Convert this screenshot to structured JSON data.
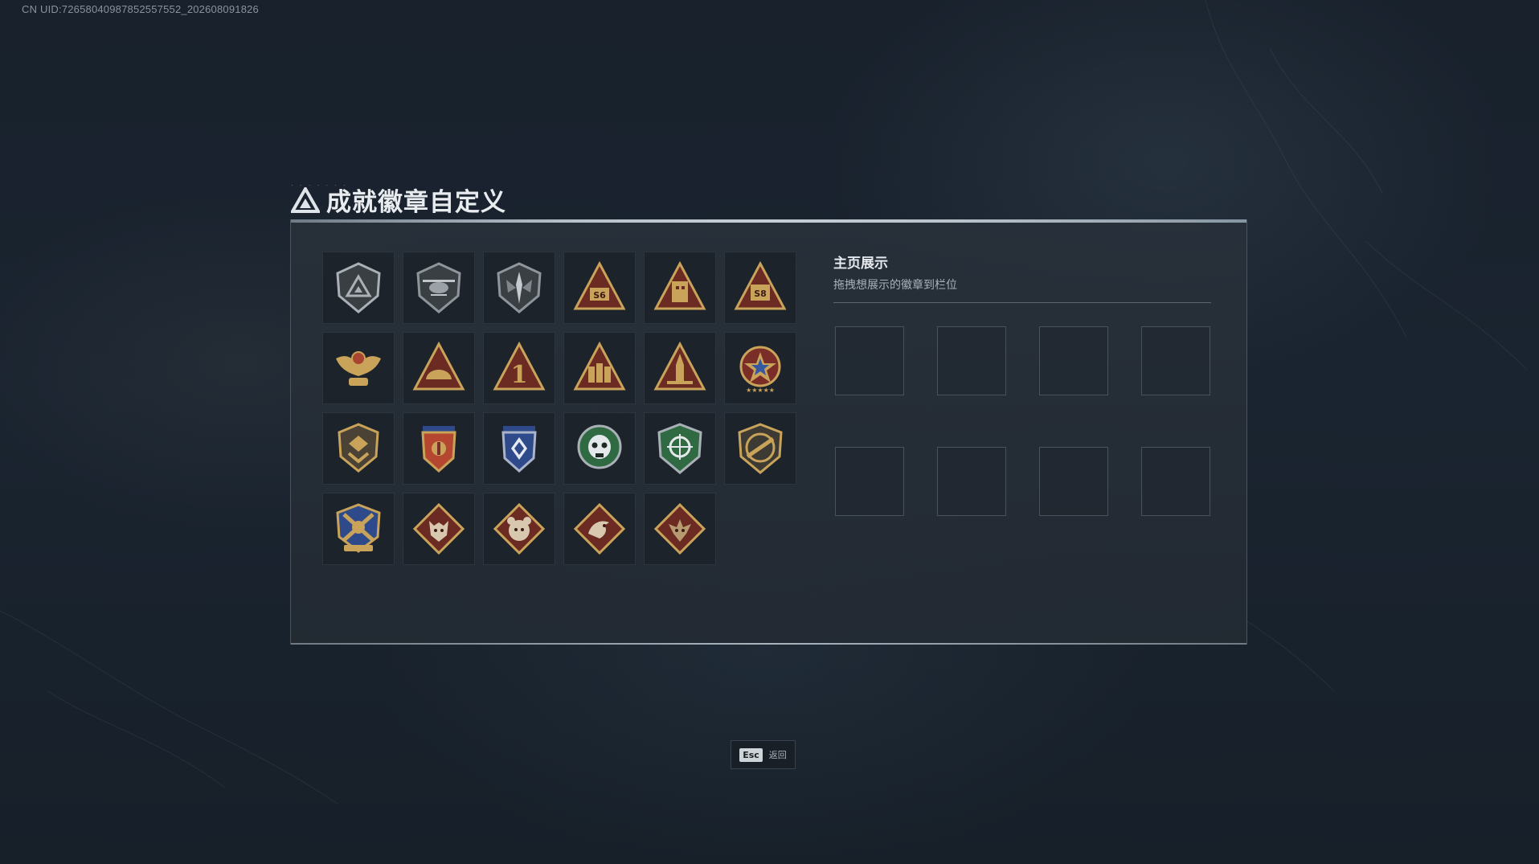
{
  "uid": "CN UID:72658040987852557552_202608091826",
  "title": "成就徽章自定义",
  "showcase": {
    "title": "主页展示",
    "subtitle": "拖拽想展示的徽章到栏位",
    "slot_count": 8
  },
  "badges": [
    {
      "icon": "shield-triangle-icon",
      "tone": "silver"
    },
    {
      "icon": "helicopter-shield-icon",
      "tone": "silver"
    },
    {
      "icon": "dagger-shield-icon",
      "tone": "silver"
    },
    {
      "icon": "triangle-s6-icon",
      "tone": "gold",
      "label": "S6"
    },
    {
      "icon": "triangle-building-icon",
      "tone": "gold"
    },
    {
      "icon": "triangle-s8-icon",
      "tone": "gold",
      "label": "S8"
    },
    {
      "icon": "eagle-crest-icon",
      "tone": "gold"
    },
    {
      "icon": "triangle-helmet-icon",
      "tone": "gold"
    },
    {
      "icon": "triangle-number-one-icon",
      "tone": "gold",
      "label": "1"
    },
    {
      "icon": "triangle-soldiers-icon",
      "tone": "gold"
    },
    {
      "icon": "triangle-rocket-icon",
      "tone": "gold"
    },
    {
      "icon": "star-medal-icon",
      "tone": "red"
    },
    {
      "icon": "shield-chevron-icon",
      "tone": "gold"
    },
    {
      "icon": "shield-flag-icon",
      "tone": "red"
    },
    {
      "icon": "shield-blue-star-icon",
      "tone": "blue"
    },
    {
      "icon": "green-skull-icon",
      "tone": "green"
    },
    {
      "icon": "green-crosshair-shield-icon",
      "tone": "green"
    },
    {
      "icon": "rifle-crest-icon",
      "tone": "gold"
    },
    {
      "icon": "crossed-shield-icon",
      "tone": "blue"
    },
    {
      "icon": "wolf-diamond-icon",
      "tone": "red"
    },
    {
      "icon": "bear-diamond-icon",
      "tone": "red"
    },
    {
      "icon": "bird-diamond-icon",
      "tone": "red"
    },
    {
      "icon": "dragon-diamond-icon",
      "tone": "red"
    }
  ],
  "esc": {
    "key": "Esc",
    "label": "返回"
  },
  "colors": {
    "gold": "#c9a35a",
    "silver": "#a9b0b6",
    "red": "#7a2e27",
    "green": "#2f6a43",
    "blue": "#2e4a8a"
  }
}
